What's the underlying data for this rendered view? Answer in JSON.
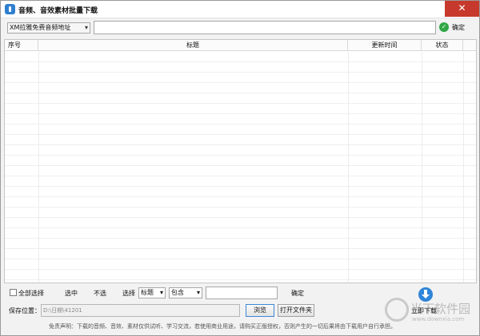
{
  "window": {
    "title": "音频、音效素材批量下载",
    "close_glyph": "✕"
  },
  "toolbar": {
    "source_select": "XM拉雅免费音频地址",
    "url_value": "",
    "confirm_label": "确定"
  },
  "table": {
    "columns": [
      "序号",
      "标题",
      "更新时间",
      "状态"
    ],
    "rows": []
  },
  "bottom": {
    "select_all_label": "全部选择",
    "selected_label": "选中",
    "unselected_label": "不选",
    "filter_label": "选择",
    "field_select": "标题",
    "match_select": "包含",
    "keyword_value": "",
    "filter_confirm_label": "确定",
    "save_location_label": "保存位置：",
    "save_path": "D:\\日期\\41201",
    "browse_label": "浏览",
    "open_folder_label": "打开文件夹",
    "download_now_label": "立即下载",
    "disclaimer": "免责声明：下载的音频、音效、素材仅供试听、学习交流，若使用商业用途，请购买正版授权，否则产生的一切后果将由下载用户自行承担。"
  },
  "watermark": {
    "text": "当下软件园",
    "url": "www.downxia.com"
  },
  "colors": {
    "close_button": "#c7392c",
    "accent": "#2f85d8",
    "ok_green": "#2fa745"
  }
}
